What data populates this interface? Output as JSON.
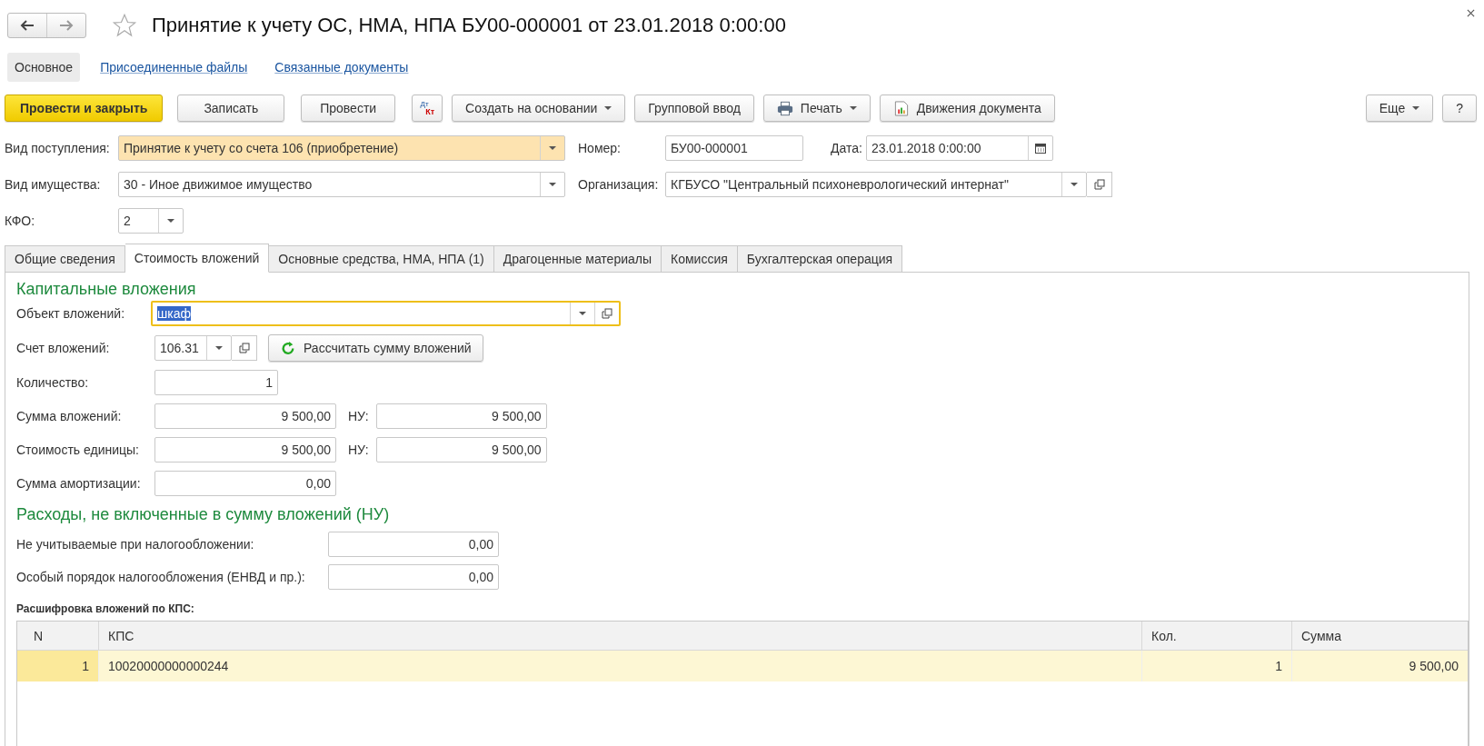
{
  "window": {
    "title": "Принятие к учету ОС, НМА, НПА БУ00-000001 от 23.01.2018 0:00:00",
    "favorite": false
  },
  "nav": [
    {
      "label": "Основное",
      "selected": true
    },
    {
      "label": "Присоединенные файлы",
      "selected": false
    },
    {
      "label": "Связанные документы",
      "selected": false
    }
  ],
  "toolbar": [
    {
      "kind": "primary",
      "label": "Провести и закрыть"
    },
    {
      "kind": "plain",
      "label": "Записать"
    },
    {
      "kind": "plain",
      "label": "Провести"
    },
    {
      "kind": "dtkt",
      "top": "Дт",
      "bottom": "Кт"
    },
    {
      "kind": "menu",
      "label": "Создать на основании"
    },
    {
      "kind": "plain",
      "label": "Групповой ввод"
    },
    {
      "kind": "print",
      "label": "Печать"
    },
    {
      "kind": "report",
      "label": "Движения документа"
    }
  ],
  "toolbar_right": [
    {
      "kind": "menu",
      "label": "Еще"
    },
    {
      "kind": "plain",
      "label": "?"
    }
  ],
  "header": {
    "receipt_type": {
      "label": "Вид поступления:",
      "value": "Принятие к учету со счета 106 (приобретение)",
      "highlighted": true
    },
    "number": {
      "label": "Номер:",
      "value": "БУ00-000001"
    },
    "date": {
      "label": "Дата:",
      "value": "23.01.2018  0:00:00"
    },
    "property_type": {
      "label": "Вид имущества:",
      "value": "30 - Иное движимое имущество",
      "highlighted": false
    },
    "organization": {
      "label": "Организация:",
      "value": "КГБУСО \"Центральный психоневрологический интернат\""
    },
    "kfo": {
      "label": "КФО:",
      "value": "2"
    }
  },
  "tabs": [
    {
      "label": "Общие сведения",
      "selected": false
    },
    {
      "label": "Стоимость вложений",
      "selected": true
    },
    {
      "label": "Основные средства, НМА, НПА (1)",
      "selected": false
    },
    {
      "label": "Драгоценные материалы",
      "selected": false
    },
    {
      "label": "Комиссия",
      "selected": false
    },
    {
      "label": "Бухгалтерская операция",
      "selected": false
    }
  ],
  "capital": {
    "title": "Капитальные вложения",
    "object": {
      "label": "Объект вложений:",
      "value": "шкаф",
      "focused": true
    },
    "account": {
      "label": "Счет вложений:",
      "value": "106.31"
    },
    "recalc_button": "Рассчитать сумму вложений",
    "quantity": {
      "label": "Количество:",
      "value": "1"
    },
    "amounts": [
      {
        "label": "Сумма вложений:",
        "value": "9 500,00",
        "tax_label": "НУ:",
        "tax_value": "9 500,00"
      },
      {
        "label": "Стоимость единицы:",
        "value": "9 500,00",
        "tax_label": "НУ:",
        "tax_value": "9 500,00"
      }
    ],
    "depreciation": {
      "label": "Сумма амортизации:",
      "value": "0,00"
    }
  },
  "expenses": {
    "title": "Расходы, не включенные в сумму вложений (НУ)",
    "fields": [
      {
        "label": "Не учитываемые при налогообложении:",
        "value": "0,00"
      },
      {
        "label": "Особый порядок налогообложения (ЕНВД и пр.):",
        "value": "0,00"
      }
    ]
  },
  "kps_table": {
    "title": "Расшифровка вложений по КПС:",
    "columns": [
      "N",
      "КПС",
      "Кол.",
      "Сумма"
    ],
    "rows": [
      {
        "cells": [
          "1",
          "10020000000000244",
          "1",
          "9 500,00"
        ],
        "selected": true
      }
    ]
  }
}
